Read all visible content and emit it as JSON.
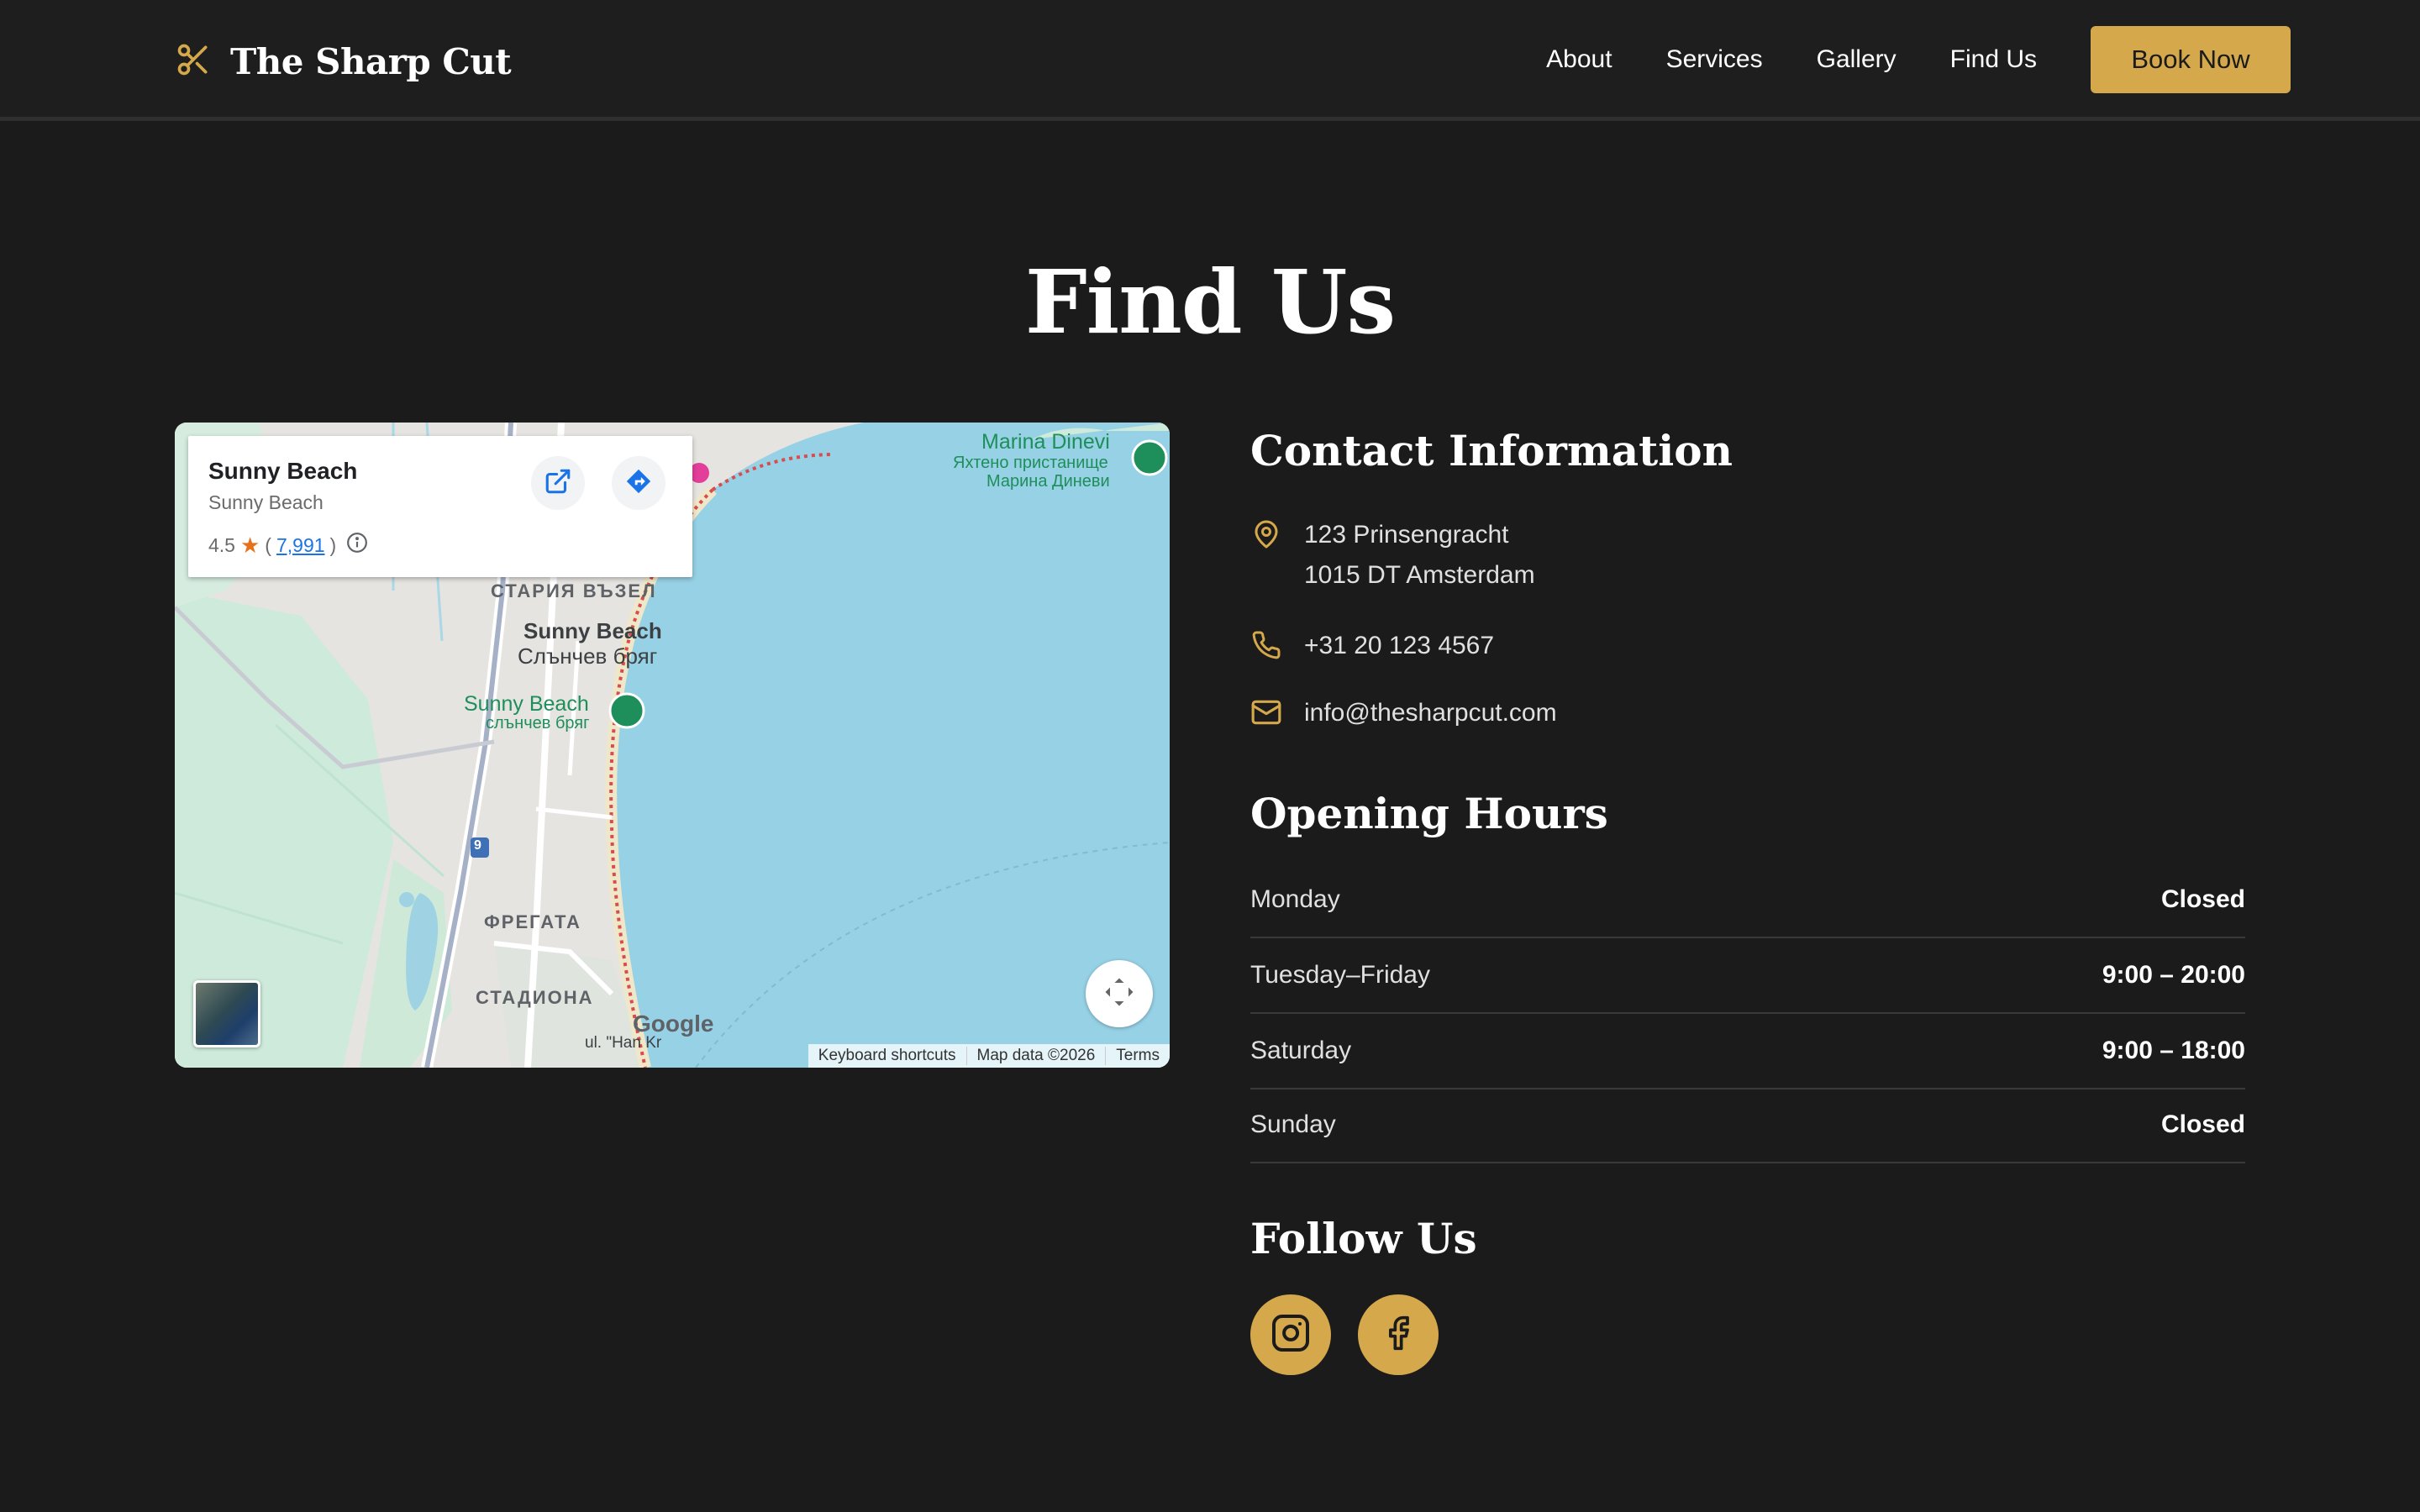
{
  "brand": {
    "name": "The Sharp Cut",
    "accent": "#d4a84b",
    "background": "#1b1b1b",
    "logo_icon": "scissors-icon"
  },
  "nav": {
    "items": [
      {
        "label": "About"
      },
      {
        "label": "Services"
      },
      {
        "label": "Gallery"
      },
      {
        "label": "Find Us"
      }
    ],
    "cta_label": "Book Now"
  },
  "page": {
    "title": "Find Us"
  },
  "map": {
    "place_name": "Sunny Beach",
    "place_sub": "Sunny Beach",
    "rating": "4.5",
    "reviews": "7,991",
    "labels": {
      "stariya": "СТАРИЯ ВЪЗЕЛ",
      "sunny_en": "Sunny Beach",
      "sunny_bg": "Слънчев бряг",
      "sunny_green_en": "Sunny Beach",
      "sunny_green_bg": "слънчев бряг",
      "marina_en": "Marina Dinevi",
      "marina_bg1": "Яхтено пристанище",
      "marina_bg2": "Марина Диневи",
      "fregata": "ФРЕГАТА",
      "stadiona": "СТАДИОНА",
      "road": "9",
      "street": "ul. \"Han Kr",
      "google": "Google"
    },
    "footer": [
      "Keyboard shortcuts",
      "Map data ©2026",
      "Terms"
    ]
  },
  "contact": {
    "title": "Contact Information",
    "address_line1": "123 Prinsengracht",
    "address_line2": "1015 DT Amsterdam",
    "phone": "+31 20 123 4567",
    "email": "info@thesharpcut.com"
  },
  "hours": {
    "title": "Opening Hours",
    "rows": [
      {
        "day": "Monday",
        "time": "Closed"
      },
      {
        "day": "Tuesday–Friday",
        "time": "9:00 – 20:00"
      },
      {
        "day": "Saturday",
        "time": "9:00 – 18:00"
      },
      {
        "day": "Sunday",
        "time": "Closed"
      }
    ]
  },
  "social": {
    "title": "Follow Us",
    "icons": [
      "instagram-icon",
      "facebook-icon"
    ]
  }
}
